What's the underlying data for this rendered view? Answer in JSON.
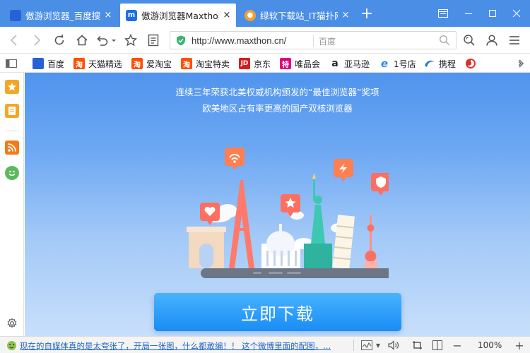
{
  "tabs": [
    {
      "title": "傲游浏览器_百度搜索",
      "close": "×",
      "active": false
    },
    {
      "title": "傲游浏览器Maxthon",
      "close": "×",
      "active": true
    },
    {
      "title": "绿软下载站_IT猫扑网",
      "close": "×",
      "active": false
    }
  ],
  "new_tab": "+",
  "address": {
    "url": "http://www.maxthon.cn/",
    "search_engine": "百度"
  },
  "bookmarks": [
    {
      "label": "百度",
      "icon": "paw-icon",
      "color": "#2b5fd9"
    },
    {
      "label": "天猫精选",
      "icon": "淘",
      "color": "#ff5000"
    },
    {
      "label": "爱淘宝",
      "icon": "淘",
      "color": "#ff5000"
    },
    {
      "label": "淘宝特卖",
      "icon": "淘",
      "color": "#ff5000"
    },
    {
      "label": "京东",
      "icon": "JD",
      "color": "#d71c1e"
    },
    {
      "label": "唯品会",
      "icon": "特",
      "color": "#e4007f"
    },
    {
      "label": "亚马逊",
      "icon": "a",
      "color": "#222222"
    },
    {
      "label": "1号店",
      "icon": "e",
      "color": "#2d8cf0"
    },
    {
      "label": "携程",
      "icon": "ctrip-icon",
      "color": "#2577e3"
    }
  ],
  "hero": {
    "line1": "连续三年荣获北美权威机构颁发的“最佳浏览器”奖项",
    "line2": "欧美地区占有率更高的国产双核浏览器",
    "download": "立即下载"
  },
  "status": {
    "news": "现在的自媒体真的是太夸张了，开局一张图，什么都敢编！！ 这个微博里面的配图，...",
    "zoom": "100%"
  },
  "colors": {
    "tabbar": "#4a8ee6",
    "content_top": "#4f94ee",
    "download": "#1a8cf5"
  }
}
